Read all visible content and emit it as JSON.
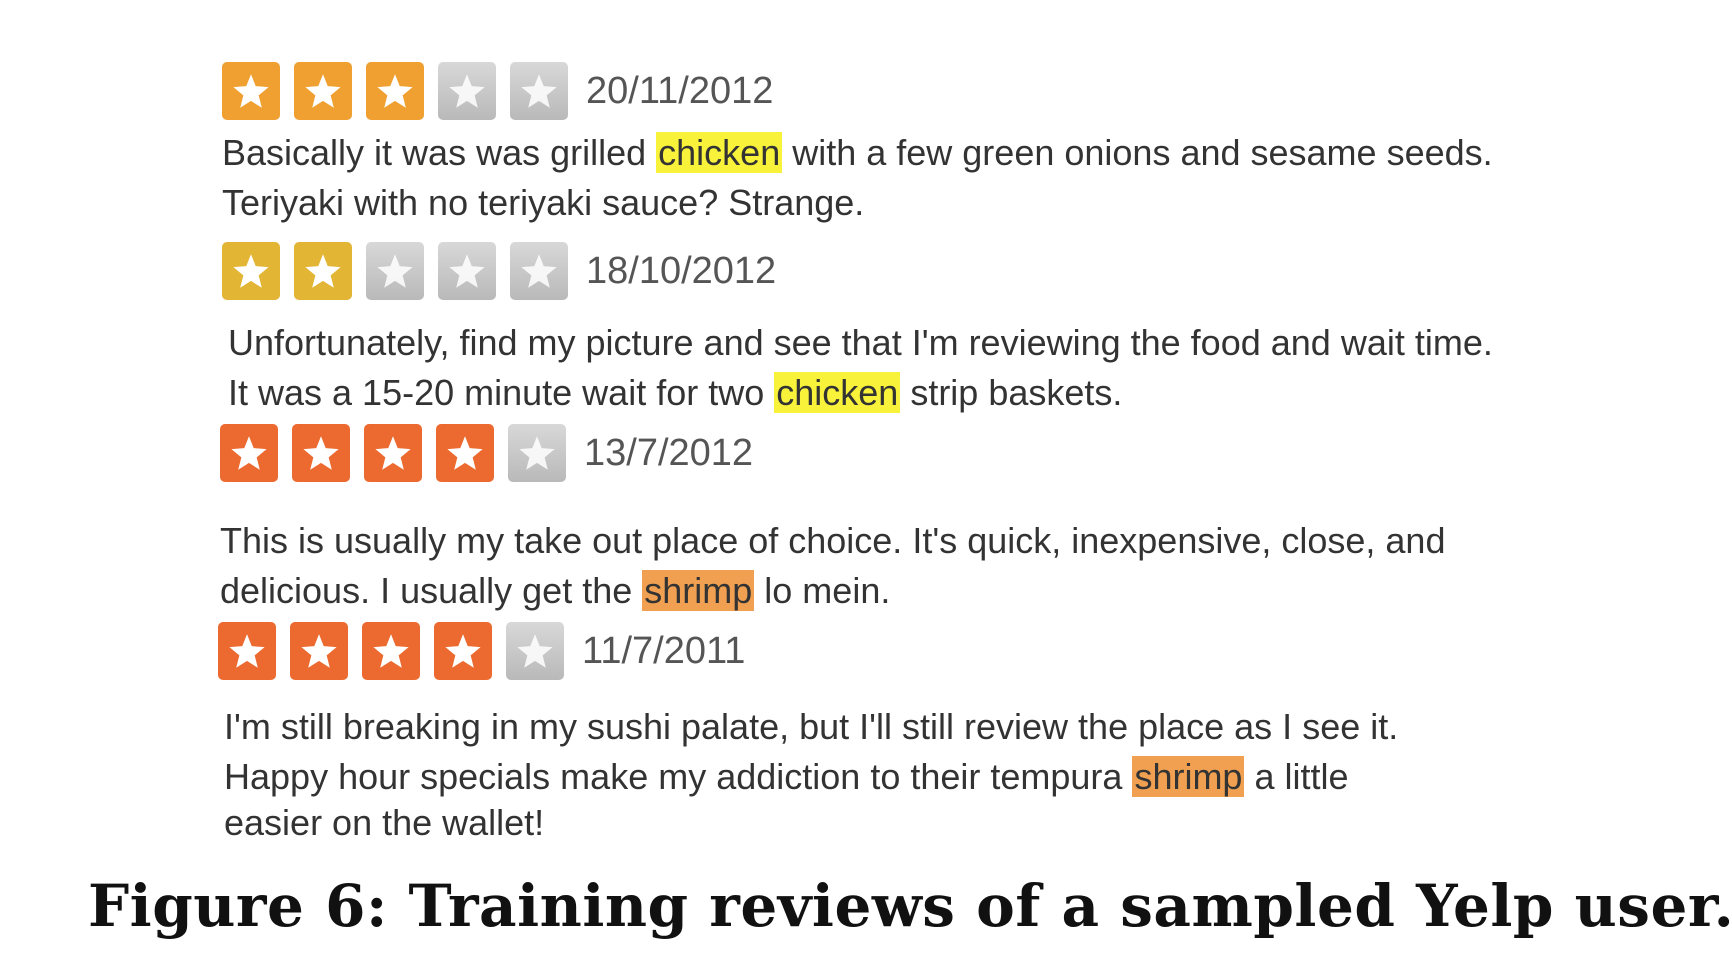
{
  "colors": {
    "star_3": "#f0a030",
    "star_2": "#e2b535",
    "star_4": "#ec6a30",
    "star_off": "#c4c4c4",
    "highlight_chicken": "#f8f23a",
    "highlight_shrimp": "#f0a050"
  },
  "reviews": [
    {
      "rating": 3,
      "date": "20/11/2012",
      "line1_pre": "Basically it was was grilled ",
      "line1_hl": "chicken",
      "line1_post": " with a few green onions and sesame seeds.",
      "line2": "Teriyaki with no teriyaki sauce? Strange."
    },
    {
      "rating": 2,
      "date": "18/10/2012",
      "line1": "Unfortunately, find my picture and see that I'm reviewing the food and wait time.",
      "line2_pre": "It was a 15-20 minute wait for two ",
      "line2_hl": "chicken",
      "line2_post": " strip baskets."
    },
    {
      "rating": 4,
      "date": "13/7/2012",
      "line1": "This is usually my take out place of choice. It's quick, inexpensive, close, and",
      "line2_pre": "delicious. I usually get the ",
      "line2_hl": "shrimp",
      "line2_post": " lo mein."
    },
    {
      "rating": 4,
      "date": "11/7/2011",
      "line1": "I'm still breaking in my sushi palate, but I'll still review the place as I see it.",
      "line2_pre": "Happy hour specials make my addiction to their tempura ",
      "line2_hl": "shrimp",
      "line2_post": " a little",
      "line3": "easier on the wallet!"
    }
  ],
  "caption": "Figure 6: Training reviews of a sampled Yelp user."
}
